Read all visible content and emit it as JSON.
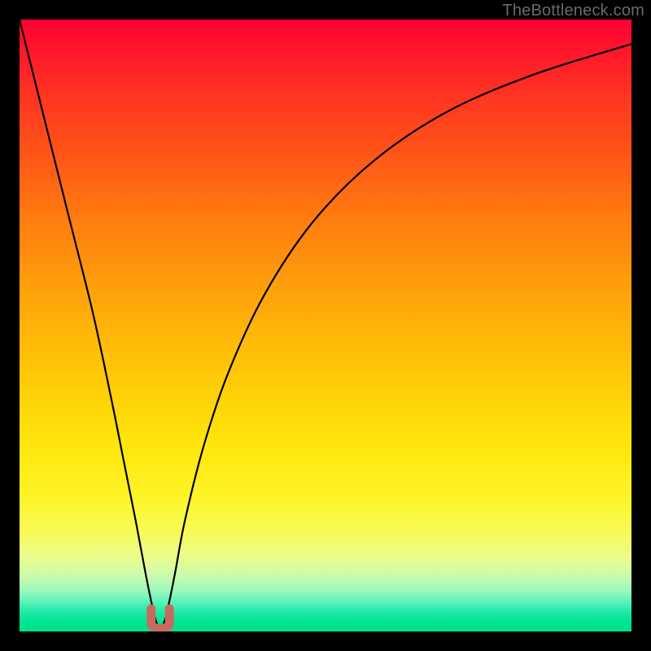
{
  "watermark": "TheBottleneck.com",
  "chart_data": {
    "type": "line",
    "title": "",
    "xlabel": "",
    "ylabel": "",
    "xlim": [
      0,
      100
    ],
    "ylim": [
      0,
      100
    ],
    "grid": false,
    "legend": false,
    "background_gradient": {
      "stops": [
        {
          "pct": 0,
          "color": "#ff0033"
        },
        {
          "pct": 50,
          "color": "#ffb808"
        },
        {
          "pct": 80,
          "color": "#fef428"
        },
        {
          "pct": 100,
          "color": "#00e38a"
        }
      ]
    },
    "series": [
      {
        "name": "curve",
        "color": "#000000",
        "x": [
          0,
          4,
          8,
          12,
          15,
          17,
          19,
          20.5,
          21.5,
          22.2,
          23.0,
          23.8,
          24.5,
          25.5,
          27,
          30,
          34,
          40,
          48,
          58,
          70,
          84,
          100
        ],
        "values": [
          100,
          84,
          68,
          52,
          38,
          28,
          18,
          10,
          5,
          2,
          0.5,
          2,
          5,
          10,
          18,
          30,
          42,
          55,
          67,
          77,
          85,
          91,
          96
        ]
      }
    ],
    "marker": {
      "name": "valley-marker",
      "shape": "u",
      "color": "#c86a5f",
      "x": 23.0,
      "y": 0.5,
      "width_x": 3.0,
      "height_y": 3.2
    }
  }
}
